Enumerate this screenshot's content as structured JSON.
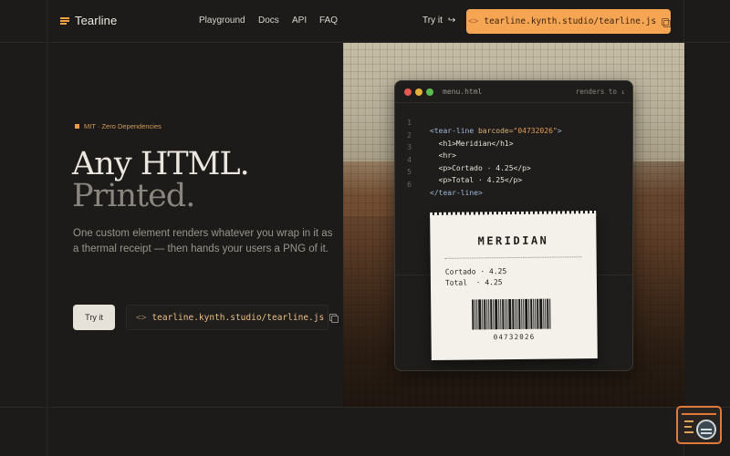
{
  "brand": {
    "name": "Tearline",
    "accent": "#f6a552"
  },
  "nav": {
    "items": [
      "Playground",
      "Docs",
      "API",
      "FAQ"
    ]
  },
  "header": {
    "try_label": "Try it",
    "try_arrow": "↪",
    "cta_prefix": "<>",
    "cta_url": "tearline.kynth.studio/tearline.js"
  },
  "hero": {
    "badge": "MIT · Zero Dependencies",
    "title_line1": "Any HTML.",
    "title_line2": "Printed.",
    "subtitle": "One custom element renders whatever you wrap in it as a thermal receipt — then hands your users a PNG of it.",
    "try_button": "Try it",
    "url_prefix": "<>",
    "url": "tearline.kynth.studio/tearline.js"
  },
  "code_window": {
    "filename": "menu.html",
    "right_label": "renders to ↓",
    "line_numbers": [
      "1",
      "2",
      "3",
      "4",
      "5",
      "6"
    ],
    "lines": [
      {
        "tag_open": "<tear-line",
        "attr": " barcode=",
        "str": "\"04732026\"",
        "tag_close": ">"
      },
      {
        "text": "  <h1>Meridian</h1>"
      },
      {
        "text": "  <hr>"
      },
      {
        "text": "  <p>Cortado · 4.25</p>"
      },
      {
        "text": "  <p>Total · 4.25</p>"
      },
      {
        "text": "</tear-line>"
      }
    ]
  },
  "receipt": {
    "title": "MERIDIAN",
    "items": [
      "Cortado · 4.25",
      "Total  · 4.25"
    ],
    "barcode_number": "04732026"
  }
}
